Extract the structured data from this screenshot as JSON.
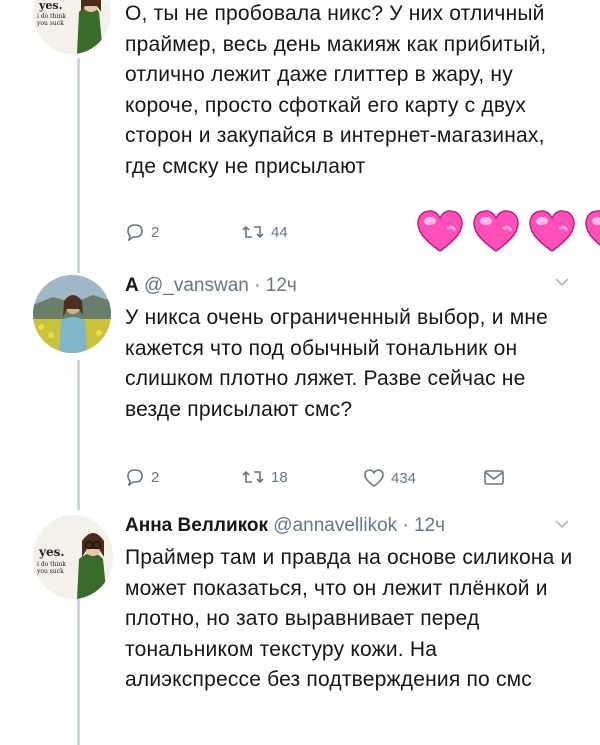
{
  "tweets": [
    {
      "avatar": "yes-i-do-think-you-suck-avatar",
      "avatar_text": [
        "yes.",
        "i do think",
        "you suck"
      ],
      "text": "О, ты не пробовала никс? У них отличный праймер, весь день макияж как прибитый, отлично лежит даже глиттер в жару, ну короче, просто сфоткай его карту с двух сторон и закупайся в интернет-магазинах, где смску не присылают",
      "replies": "2",
      "retweets": "44",
      "overlay": "pink-hearts-sticker"
    },
    {
      "avatar": "woman-in-flower-field-avatar",
      "name": "A",
      "handle": "@_vanswan",
      "time": "· 12ч",
      "text": "У никса очень ограниченный выбор, и мне кажется что под обычный тональник он слишком плотно ляжет. Разве сейчас не везде присылают смс?",
      "replies": "2",
      "retweets": "18",
      "likes": "434"
    },
    {
      "avatar": "yes-i-do-think-you-suck-avatar",
      "avatar_text": [
        "yes.",
        "i do think",
        "you suck"
      ],
      "name": "Анна Велликок",
      "handle": "@annavellikok",
      "time": "· 12ч",
      "text": "Праймер там и правда на основе силикона и может показаться, что он лежит плёнкой и плотно, но зато выравнивает перед тональником текстуру кожи. На алиэкспрессе без подтверждения по смс"
    }
  ]
}
